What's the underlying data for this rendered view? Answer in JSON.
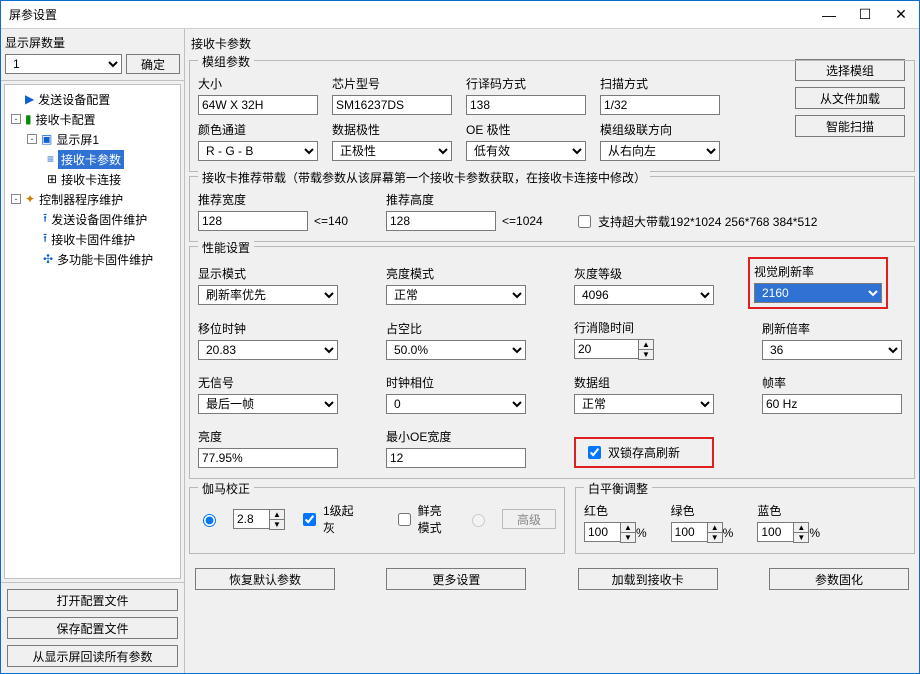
{
  "window": {
    "title": "屏参设置",
    "min": "—",
    "max": "☐",
    "close": "✕"
  },
  "left": {
    "count_label": "显示屏数量",
    "count_value": "1",
    "confirm": "确定",
    "open_cfg": "打开配置文件",
    "save_cfg": "保存配置文件",
    "readback": "从显示屏回读所有参数"
  },
  "tree": {
    "send_cfg": "发送设备配置",
    "recv_cfg": "接收卡配置",
    "display1": "显示屏1",
    "recv_params": "接收卡参数",
    "recv_conn": "接收卡连接",
    "ctrl_maint": "控制器程序维护",
    "send_fw": "发送设备固件维护",
    "recv_fw": "接收卡固件维护",
    "multi_fw": "多功能卡固件维护"
  },
  "panel_title": "接收卡参数",
  "module": {
    "legend": "模组参数",
    "size_label": "大小",
    "size_value": "64W X 32H",
    "chip_label": "芯片型号",
    "chip_value": "SM16237DS",
    "decode_label": "行译码方式",
    "decode_value": "138",
    "scan_label": "扫描方式",
    "scan_value": "1/32",
    "color_label": "颜色通道",
    "color_value": "R - G - B",
    "polarity_label": "数据极性",
    "polarity_value": "正极性",
    "oe_label": "OE 极性",
    "oe_value": "低有效",
    "cascade_label": "模组级联方向",
    "cascade_value": "从右向左",
    "btn_select": "选择模组",
    "btn_load": "从文件加载",
    "btn_smart": "智能扫描"
  },
  "rec_load": {
    "legend": "接收卡推荐带载（带载参数从该屏幕第一个接收卡参数获取，在接收卡连接中修改）",
    "rec_w_label": "推荐宽度",
    "rec_w_value": "128",
    "rec_w_hint": "<=140",
    "rec_h_label": "推荐高度",
    "rec_h_value": "128",
    "rec_h_hint": "<=1024",
    "big_load": "支持超大带载192*1024 256*768 384*512"
  },
  "perf": {
    "legend": "性能设置",
    "disp_mode_label": "显示模式",
    "disp_mode_value": "刷新率优先",
    "bright_mode_label": "亮度模式",
    "bright_mode_value": "正常",
    "gray_label": "灰度等级",
    "gray_value": "4096",
    "vrr_label": "视觉刷新率",
    "vrr_value": "2160",
    "shift_label": "移位时钟",
    "shift_value": "20.83",
    "duty_label": "占空比",
    "duty_value": "50.0%",
    "blank_label": "行消隐时间",
    "blank_value": "20",
    "refresh_mul_label": "刷新倍率",
    "refresh_mul_value": "36",
    "nosig_label": "无信号",
    "nosig_value": "最后一帧",
    "clk_phase_label": "时钟相位",
    "clk_phase_value": "0",
    "data_group_label": "数据组",
    "data_group_value": "正常",
    "frame_label": "帧率",
    "frame_value": "60 Hz",
    "bright_label": "亮度",
    "bright_value": "77.95%",
    "min_oe_label": "最小OE宽度",
    "min_oe_value": "12",
    "dual_latch": "双锁存高刷新"
  },
  "gamma": {
    "legend": "伽马校正",
    "value": "2.8",
    "from1": "1级起灰",
    "vivid": "鲜亮模式",
    "adv": "高级"
  },
  "wb": {
    "legend": "白平衡调整",
    "r": "红色",
    "g": "绿色",
    "b": "蓝色",
    "rv": "100",
    "gv": "100",
    "bv": "100",
    "pct": "%"
  },
  "actions": {
    "restore": "恢复默认参数",
    "more": "更多设置",
    "load_to_card": "加载到接收卡",
    "solidify": "参数固化"
  }
}
